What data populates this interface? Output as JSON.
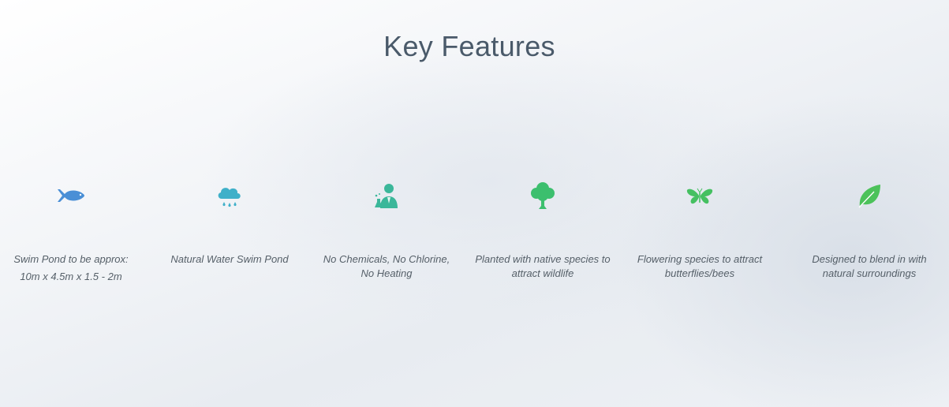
{
  "slide": {
    "title": "Key Features",
    "features": [
      {
        "icon": "fish-icon",
        "text": "Swim Pond to be approx:",
        "text2": "10m x 4.5m x 1.5 - 2m",
        "color": "#4a8fd6"
      },
      {
        "icon": "rain-cloud-icon",
        "text": "Natural Water Swim Pond",
        "color": "#3fb0c9"
      },
      {
        "icon": "scientist-icon",
        "text": "No Chemicals, No Chlorine, No Heating",
        "color": "#3bb79a"
      },
      {
        "icon": "tree-icon",
        "text": "Planted with native species to attract wildlife",
        "color": "#3cbf6e"
      },
      {
        "icon": "butterfly-icon",
        "text": "Flowering species to attract butterflies/bees",
        "color": "#45c061"
      },
      {
        "icon": "leaf-icon",
        "text": "Designed to blend in with natural surroundings",
        "color": "#4cc25a"
      }
    ]
  }
}
